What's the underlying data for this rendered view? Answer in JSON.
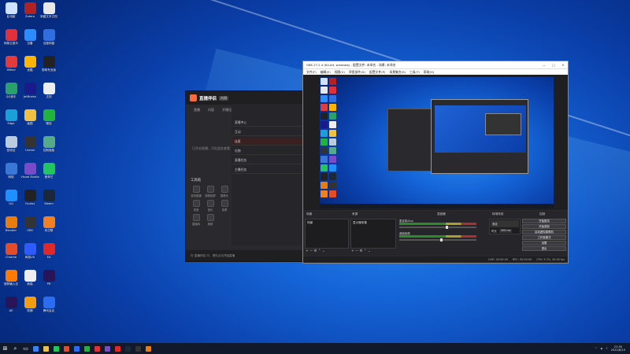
{
  "desktop": {
    "icons": [
      {
        "label": "此电脑",
        "color": "#cfe3ff"
      },
      {
        "label": "Zotero",
        "color": "#b22222"
      },
      {
        "label": "新建文本文档",
        "color": "#e8e8e8"
      },
      {
        "label": "网易云音乐",
        "color": "#e0303a"
      },
      {
        "label": "迅雷",
        "color": "#2a8cff"
      },
      {
        "label": "百度网盘",
        "color": "#2f6ee0"
      },
      {
        "label": "XMind",
        "color": "#e33b3b"
      },
      {
        "label": "优酷",
        "color": "#ffb400"
      },
      {
        "label": "剪映专业版",
        "color": "#222"
      },
      {
        "label": "QQ音乐",
        "color": "#2aa06a"
      },
      {
        "label": "JetBrains",
        "color": "#1a1a8c"
      },
      {
        "label": "文档",
        "color": "#eee"
      },
      {
        "label": "Edge",
        "color": "#19a0d8"
      },
      {
        "label": "画图",
        "color": "#f0c040"
      },
      {
        "label": "微信",
        "color": "#20b43c"
      },
      {
        "label": "回收站",
        "color": "#bcd"
      },
      {
        "label": "Unreal",
        "color": "#333"
      },
      {
        "label": "控制面板",
        "color": "#5a8"
      },
      {
        "label": "网络",
        "color": "#3a78d8"
      },
      {
        "label": "Visual Studio",
        "color": "#7a4bc9"
      },
      {
        "label": "爱奇艺",
        "color": "#22c55e"
      },
      {
        "label": "QQ",
        "color": "#1e90ff"
      },
      {
        "label": "Oculus",
        "color": "#222"
      },
      {
        "label": "Steam",
        "color": "#1b2838"
      },
      {
        "label": "Blender",
        "color": "#e87d0d"
      },
      {
        "label": "OBS",
        "color": "#333"
      },
      {
        "label": "向日葵",
        "color": "#f08020"
      },
      {
        "label": "Chrome",
        "color": "#e34c26"
      },
      {
        "label": "网易UU",
        "color": "#2e5bff"
      },
      {
        "label": "EA",
        "color": "#e02828"
      },
      {
        "label": "搜狗输入法",
        "color": "#ff7a00"
      },
      {
        "label": "熊猫",
        "color": "#eee"
      },
      {
        "label": "PR",
        "color": "#2a1458"
      },
      {
        "label": "AE",
        "color": "#2a1458"
      },
      {
        "label": "剪辑",
        "color": "#f39c12"
      },
      {
        "label": "腾讯会议",
        "color": "#2a6df0"
      }
    ]
  },
  "helper": {
    "title": "直播伴侣",
    "version": "内测",
    "tabs": [
      "直播",
      "内容",
      "开播设置"
    ],
    "left_hint": "已开启直播，可在此处查看",
    "tools_heading": "工具箱",
    "tools": [
      "游戏直播",
      "视频投屏",
      "摄像头",
      "录音",
      "音乐",
      "录屏",
      "直播间",
      "美颜"
    ],
    "panel_rows": [
      "直播中心",
      "互动",
      "连麦",
      "礼物",
      "直播任务",
      "主播任务"
    ],
    "bottom_text": "在 直播伴侣 中，请先点击开始直播"
  },
  "obs": {
    "title": "OBS 27.2.4 (64-bit, windows) - 配置文件: 未命名 - 场景: 未命名",
    "window_buttons": [
      "—",
      "▢",
      "✕"
    ],
    "menu": [
      "文件(F)",
      "编辑(E)",
      "视图(V)",
      "停靠部件(D)",
      "配置文件(P)",
      "场景集合(S)",
      "工具(T)",
      "帮助(H)"
    ],
    "docks": {
      "scenes": "场景",
      "sources": "来源",
      "mixer": "混音器",
      "transitions": "转场特效",
      "controls": "控制"
    },
    "scene_items": [
      "场景"
    ],
    "source_items": [
      "显示器采集"
    ],
    "mixer_items": [
      {
        "name": "麦克风/Aux",
        "level": 0.62
      },
      {
        "name": "桌面音频",
        "level": 0.55
      }
    ],
    "transition": {
      "type": "渐变",
      "duration_label": "时长",
      "duration": "300 ms"
    },
    "control_buttons": [
      "开始推流",
      "开始录制",
      "启动虚拟摄像机",
      "工作室模式",
      "设置",
      "退出"
    ],
    "status": [
      "LIVE: 00:00:00",
      "REC: 00:00:00",
      "CPU: 5.7%, 30.00 fps"
    ]
  },
  "taskbar": {
    "search_placeholder": "",
    "apps": [
      "#3b82f6",
      "#f0c040",
      "#22c55e",
      "#e34c26",
      "#2a6df0",
      "#20b43c",
      "#e0303a",
      "#7a4bc9",
      "#e02828",
      "#1b2838",
      "#333",
      "#e87d0d"
    ],
    "time": "21:30",
    "date": "2022/8/10"
  }
}
